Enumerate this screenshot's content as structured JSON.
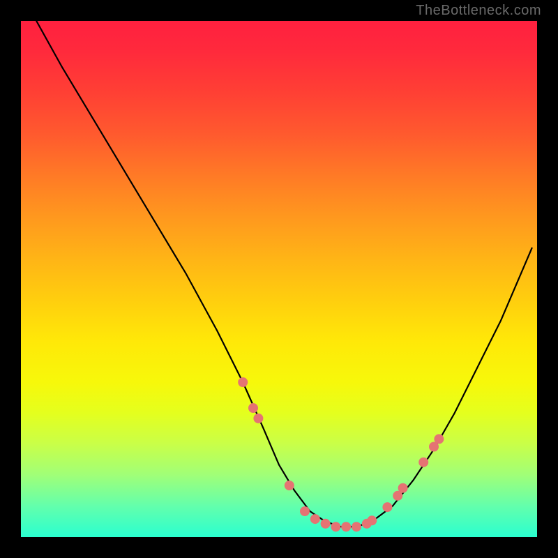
{
  "watermark": "TheBottleneck.com",
  "chart_data": {
    "type": "line",
    "title": "",
    "xlabel": "",
    "ylabel": "",
    "xlim": [
      0,
      100
    ],
    "ylim": [
      0,
      100
    ],
    "series": [
      {
        "name": "curve",
        "color": "#000000",
        "x": [
          3,
          8,
          14,
          20,
          26,
          32,
          38,
          43,
          47,
          50,
          53,
          56,
          59,
          62,
          65,
          68,
          72,
          76,
          80,
          84,
          88,
          93,
          99
        ],
        "y": [
          100,
          91,
          81,
          71,
          61,
          51,
          40,
          30,
          21,
          14,
          9,
          5,
          3,
          2,
          2,
          3,
          6,
          11,
          17,
          24,
          32,
          42,
          56
        ]
      }
    ],
    "markers": {
      "name": "dots",
      "color": "#e57373",
      "radius": 7,
      "points": [
        {
          "x": 43,
          "y": 30
        },
        {
          "x": 45,
          "y": 25
        },
        {
          "x": 46,
          "y": 23
        },
        {
          "x": 52,
          "y": 10
        },
        {
          "x": 55,
          "y": 5
        },
        {
          "x": 57,
          "y": 3.5
        },
        {
          "x": 59,
          "y": 2.6
        },
        {
          "x": 61,
          "y": 2.0
        },
        {
          "x": 63,
          "y": 2.0
        },
        {
          "x": 65,
          "y": 2.0
        },
        {
          "x": 67,
          "y": 2.6
        },
        {
          "x": 68,
          "y": 3.2
        },
        {
          "x": 71,
          "y": 5.8
        },
        {
          "x": 73,
          "y": 8.0
        },
        {
          "x": 74,
          "y": 9.5
        },
        {
          "x": 78,
          "y": 14.5
        },
        {
          "x": 80,
          "y": 17.5
        },
        {
          "x": 81,
          "y": 19.0
        }
      ]
    },
    "gradient_stops": [
      {
        "pos": 0,
        "color": "#ff203f"
      },
      {
        "pos": 50,
        "color": "#ffcc10"
      },
      {
        "pos": 100,
        "color": "#2affd0"
      }
    ]
  }
}
